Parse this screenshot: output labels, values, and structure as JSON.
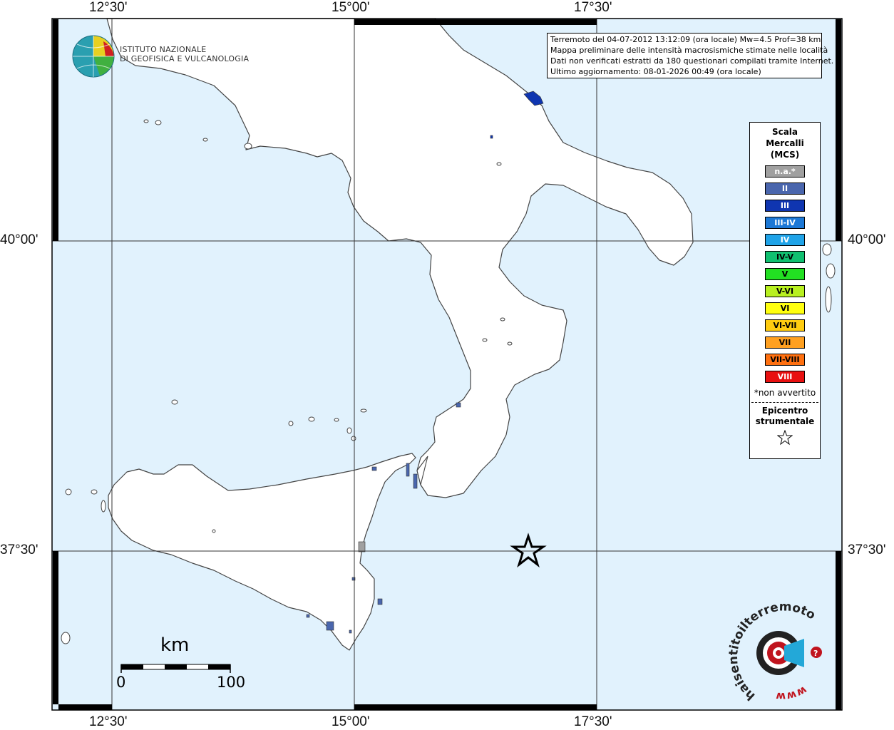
{
  "axes": {
    "top": [
      "12°30'",
      "15°00'",
      "17°30'"
    ],
    "bottom": [
      "12°30'",
      "15°00'",
      "17°30'"
    ],
    "left": [
      "40°00'",
      "37°30'"
    ],
    "right": [
      "40°00'",
      "37°30'"
    ]
  },
  "info": {
    "line1": "Terremoto del 04-07-2012 13:12:09 (ora locale) Mw=4.5 Prof=38 km",
    "line2": "Mappa preliminare delle intensità macrosismiche stimate nelle località",
    "line3": "Dati non verificati estratti da 180 questionari compilati tramite Internet.",
    "line4": "Ultimo aggiornamento: 08-01-2026 00:49 (ora locale)"
  },
  "institute": {
    "line1": "ISTITUTO NAZIONALE",
    "line2": "DI GEOFISICA E VULCANOLOGIA"
  },
  "legend": {
    "title1": "Scala",
    "title2": "Mercalli",
    "title3": "(MCS)",
    "classes": [
      {
        "label": "n.a.*",
        "color": "#a0a0a0",
        "text": "#ffffff"
      },
      {
        "label": "II",
        "color": "#4a66ad",
        "text": "#ffffff"
      },
      {
        "label": "III",
        "color": "#0f35b0",
        "text": "#ffffff"
      },
      {
        "label": "III-IV",
        "color": "#1c78d6",
        "text": "#ffffff"
      },
      {
        "label": "IV",
        "color": "#1fa3e8",
        "text": "#ffffff"
      },
      {
        "label": "IV-V",
        "color": "#10c070",
        "text": "#000000"
      },
      {
        "label": "V",
        "color": "#22e022",
        "text": "#000000"
      },
      {
        "label": "V-VI",
        "color": "#b8f020",
        "text": "#000000"
      },
      {
        "label": "VI",
        "color": "#ffff10",
        "text": "#000000"
      },
      {
        "label": "VI-VII",
        "color": "#ffcc10",
        "text": "#000000"
      },
      {
        "label": "VII",
        "color": "#ffa020",
        "text": "#000000"
      },
      {
        "label": "VII-VIII",
        "color": "#ff7010",
        "text": "#000000"
      },
      {
        "label": "VIII",
        "color": "#e81010",
        "text": "#ffffff"
      }
    ],
    "note": "*non avvertito",
    "epicentre1": "Epicentro",
    "epicentre2": "strumentale"
  },
  "scalebar": {
    "unit": "km",
    "min": "0",
    "max": "100"
  },
  "colors": {
    "sea": "#e1f2fd",
    "land": "#ffffff",
    "coast": "#444444"
  }
}
